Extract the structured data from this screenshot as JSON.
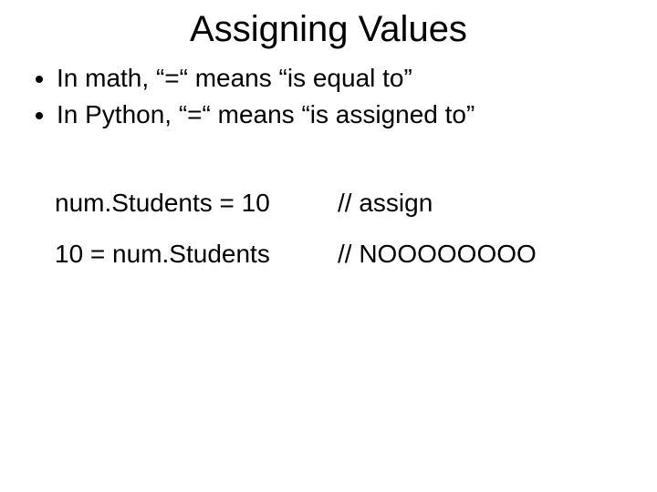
{
  "title": "Assigning Values",
  "bullets": [
    "In math, “=“ means “is equal to”",
    "In Python, “=“ means “is assigned to”"
  ],
  "code_rows": [
    {
      "left": "num.Students = 10",
      "right": "// assign"
    },
    {
      "left": "10 = num.Students",
      "right": "//  NOOOOOOOO"
    }
  ]
}
